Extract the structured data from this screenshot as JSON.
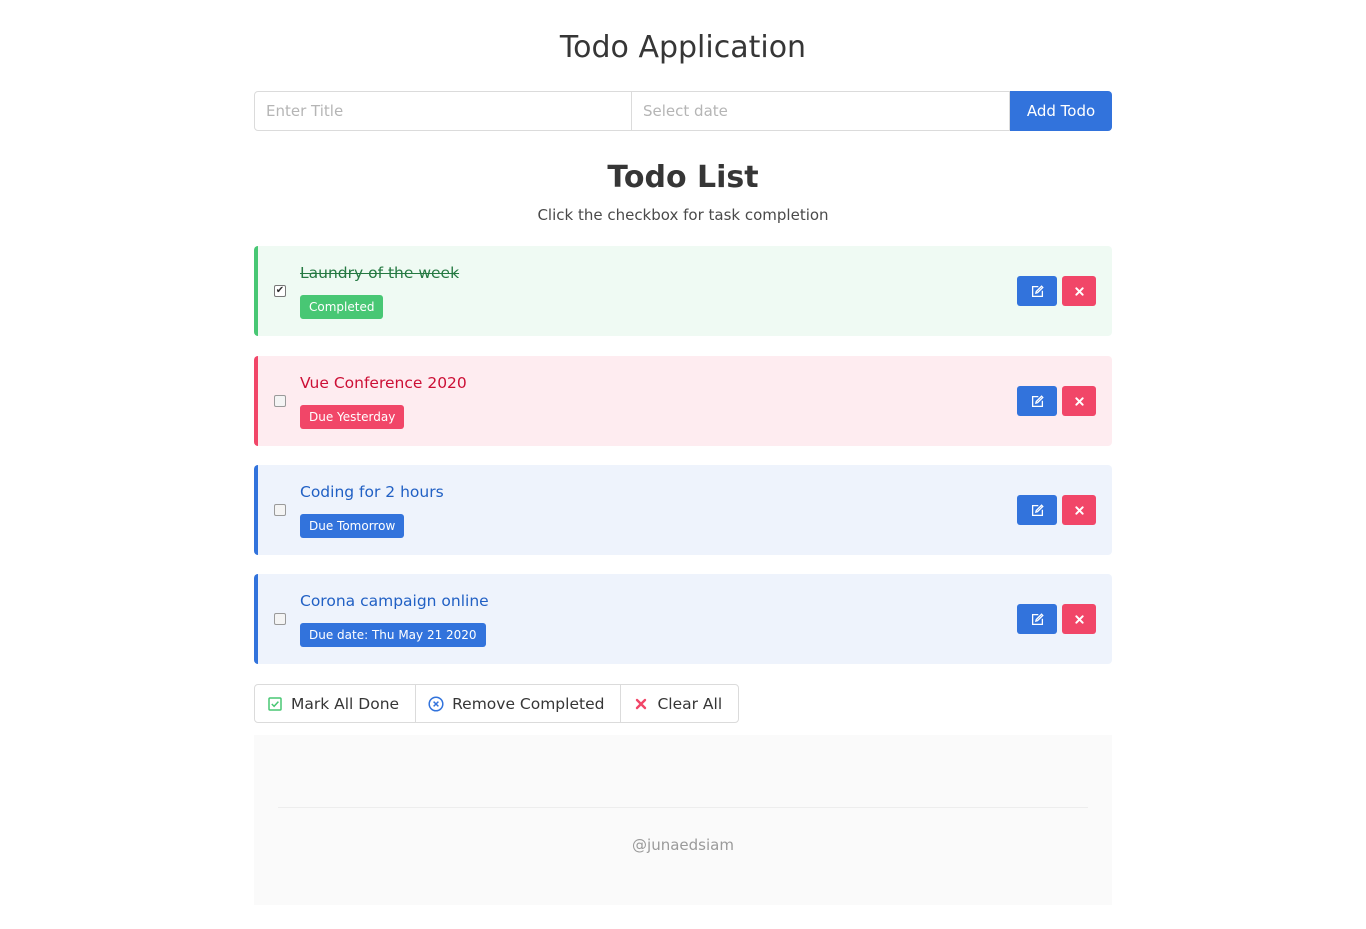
{
  "header": {
    "title": "Todo Application"
  },
  "add_form": {
    "title_placeholder": "Enter Title",
    "title_value": "",
    "date_placeholder": "Select date",
    "date_value": "",
    "add_button": "Add Todo"
  },
  "list": {
    "title": "Todo List",
    "subtitle": "Click the checkbox for task completion",
    "todos": [
      {
        "title": "Laundry of the week",
        "tag": "Completed",
        "checked": true,
        "status": "success"
      },
      {
        "title": "Vue Conference 2020",
        "tag": "Due Yesterday",
        "checked": false,
        "status": "danger"
      },
      {
        "title": "Coding for 2 hours",
        "tag": "Due Tomorrow",
        "checked": false,
        "status": "info"
      },
      {
        "title": "Corona campaign online",
        "tag": "Due date: Thu May 21 2020",
        "checked": false,
        "status": "info"
      }
    ]
  },
  "actions": {
    "mark_all_done": "Mark All Done",
    "remove_completed": "Remove Completed",
    "clear_all": "Clear All"
  },
  "footer": {
    "handle": "@junaedsiam"
  },
  "colors": {
    "primary": "#3273dc",
    "success": "#48c774",
    "danger": "#f14668"
  },
  "icons": {
    "edit": "edit-icon",
    "delete": "times-icon",
    "mark_all": "check-square-icon",
    "remove_completed": "times-circle-icon",
    "clear_all": "times-icon"
  }
}
